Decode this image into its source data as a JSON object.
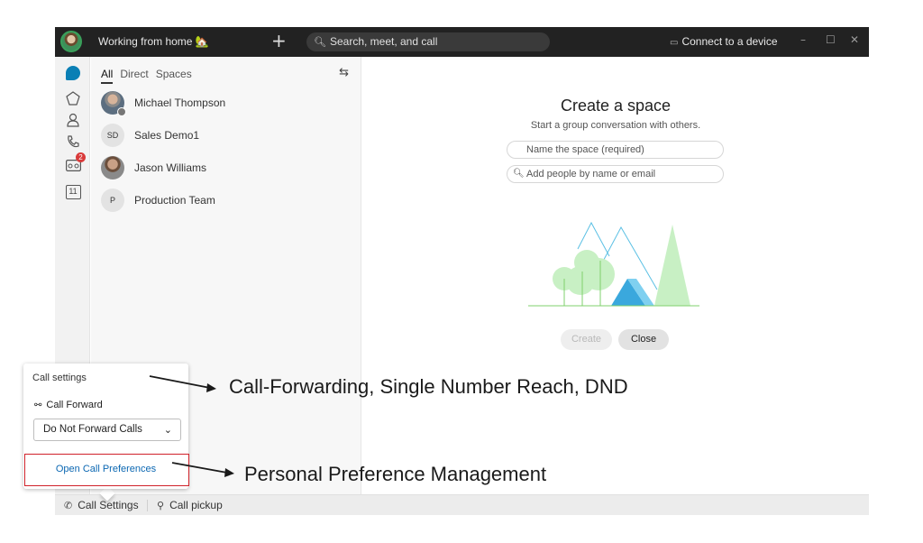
{
  "titlebar": {
    "status": "Working from home 🏡",
    "plus": "+",
    "search_placeholder": "Search, meet, and call",
    "connect_label": "Connect to a device",
    "minimize": "–",
    "maximize": "☐",
    "close": "✕"
  },
  "rail": {
    "icons": [
      "messages-icon",
      "teams-icon",
      "contacts-icon",
      "calls-icon",
      "voicemail-icon",
      "calendar-icon"
    ],
    "voicemail_badge": "2",
    "calendar_day": "11"
  },
  "list": {
    "filters": [
      "All",
      "Direct",
      "Spaces"
    ],
    "items": [
      {
        "name": "Michael Thompson",
        "initials": ""
      },
      {
        "name": "Sales Demo1",
        "initials": "SD"
      },
      {
        "name": "Jason Williams",
        "initials": ""
      },
      {
        "name": "Production Team",
        "initials": "P"
      }
    ]
  },
  "main": {
    "title": "Create a space",
    "subtitle": "Start a group conversation with others.",
    "name_placeholder": "Name the space (required)",
    "people_placeholder": "Add people by name or email",
    "create_label": "Create",
    "close_label": "Close"
  },
  "bottombar": {
    "call_settings": "Call Settings",
    "call_pickup": "Call pickup"
  },
  "popup": {
    "title": "Call settings",
    "forward_label": "Call Forward",
    "forward_value": "Do Not Forward Calls",
    "link": "Open Call Preferences"
  },
  "annotations": {
    "forwarding": "Call-Forwarding, Single Number Reach, DND",
    "preference": "Personal Preference Management"
  },
  "colors": {
    "titlebar_bg": "#222222",
    "accent_blue": "#0a7fb5",
    "highlight_red": "#d0222a",
    "link_blue": "#0b67b2"
  }
}
